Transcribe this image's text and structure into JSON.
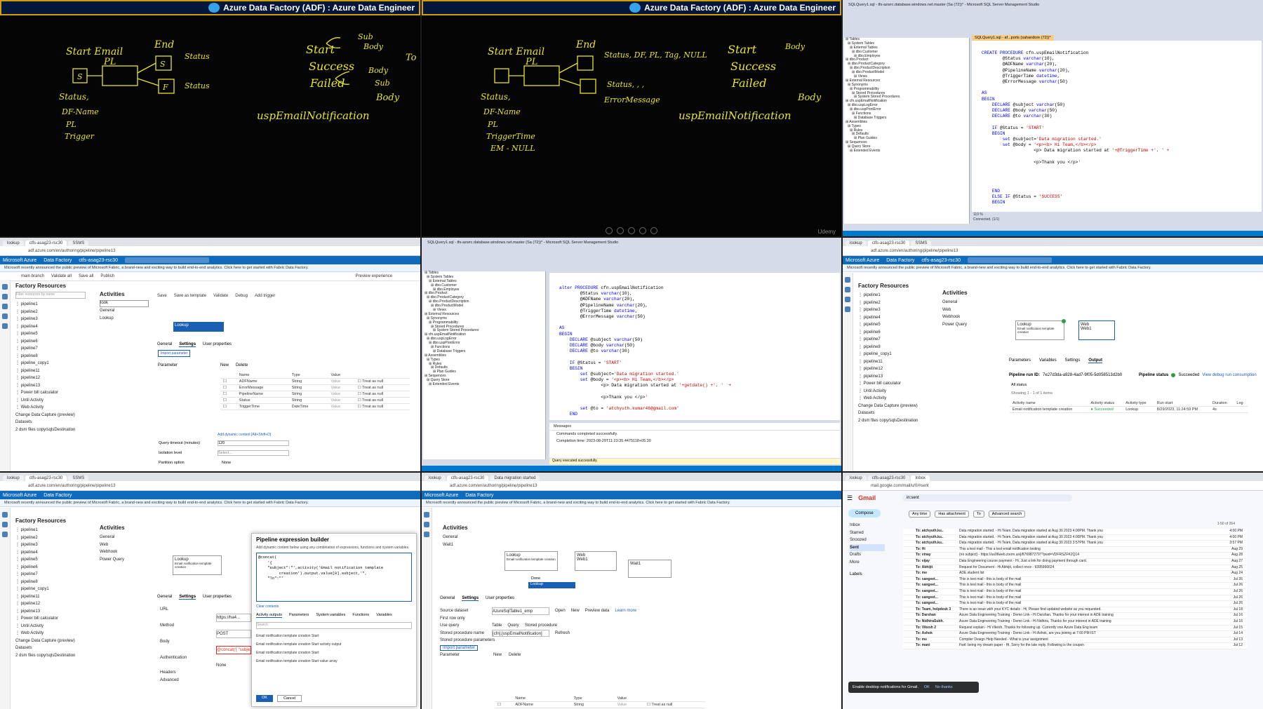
{
  "whiteboard": {
    "banner_title": "Azure Data Factory (ADF) : Azure Data Engineer",
    "watermark": "Udemy",
    "left_sketch": {
      "start_email": "Start Email",
      "pl": "PL",
      "end": "End",
      "s": "S",
      "f": "F",
      "status": "Status",
      "status_label": "Status,",
      "df_name": "DF-Name",
      "pl2": "PL",
      "trigger": "Trigger",
      "start": "Start",
      "success": "Success",
      "failed": "Failed",
      "sub": "Sub",
      "body": "Body",
      "to": "To",
      "sp": "uspEmailNotification"
    },
    "right_sketch": {
      "status_line": "Status, DF, PL, Tag, NULL",
      "error_line": "Status, , ,",
      "error_message": "ErrorMessage",
      "triggertime": "TriggerTime",
      "em_null": "EM - NULL"
    }
  },
  "ssms_top": {
    "title": "SQLQuery1.sql - tfs-azwrc.database.windows.net.master (Sa (72))* - Microsoft SQL Server Management Studio",
    "tab": "SQLQuery1.sql - af...ports (sahandore (72))*",
    "zoom": "110 %",
    "status": "Connected. (1/1)",
    "code": [
      "CREATE PROCEDURE cfn.uspEmailNotification",
      "        @Status varchar(10),",
      "        @ADFName varchar(20),",
      "        @PipelineName varchar(20),",
      "        @TriggerTime datetime,",
      "        @ErrorMessage varchar(50)",
      "",
      "AS",
      "BEGIN",
      "    DECLARE @subject varchar(50)",
      "    DECLARE @body varchar(50)",
      "    DECLARE @to varchar(30)",
      "",
      "    IF @Status = 'START'",
      "    BEGIN",
      "        set @subject='Data migration started.'",
      "        set @body = '<p><b> Hi Team,</b></p>",
      "                    <p> Data migration started at '+@TriggerTime +'. ' +",
      "",
      "                    <p>Thank you </p>'",
      "",
      "",
      "",
      "",
      "    END",
      "    ELSE IF @Status = 'SUCCESS'",
      "    BEGIN"
    ]
  },
  "ssms_mid": {
    "title": "SQLQuery1.sql - tfs-azwrc.database.windows.net.master (Sa (72))* - Microsoft SQL Server Management Studio",
    "messages_tab": "Messages",
    "message": "Commands completed successfully.",
    "completion": "Completion time: 2023-08-29T11:23:35.4475118+05:30",
    "query_status": "Query executed successfully.",
    "code": [
      "alter PROCEDURE cfn.uspEmailNotification",
      "        @Status varchar(10),",
      "        @ADFName varchar(20),",
      "        @PipelineName varchar(20),",
      "        @TriggerTime datetime,",
      "        @ErrorMessage varchar(50)",
      "",
      "AS",
      "BEGIN",
      "    DECLARE @subject varchar(50)",
      "    DECLARE @body varchar(50)",
      "    DECLARE @to varchar(30)",
      "",
      "    IF @Status = 'START'",
      "    BEGIN",
      "        set @subject='Data migration started.'",
      "        set @body = '<p><b> Hi Team,</b></p>",
      "                <p> Data migration started at '+getdate() +'. '  +",
      "",
      "                <p>Thank you </p>'",
      "",
      "        set @to = 'atchyuth.kumar46@gmail.com'",
      "    END"
    ]
  },
  "object_explorer_items": [
    "Tables",
    "System Tables",
    "External Tables",
    "dbo.Customer",
    "dbo.Employee",
    "dbo.Product",
    "dbo.ProductCategory",
    "dbo.ProductDescription",
    "dbo.ProductModel",
    "Views",
    "External Resources",
    "Synonyms",
    "Programmability",
    "Stored Procedures",
    "System Stored Procedures",
    "cfn.uspEmailNotification",
    "dbo.uspLogError",
    "dbo.uspPrintError",
    "Functions",
    "Database Triggers",
    "Assemblies",
    "Types",
    "Rules",
    "Defaults",
    "Plan Guides",
    "Sequences",
    "Query Store",
    "Extended Events"
  ],
  "azure": {
    "brand": "Microsoft Azure",
    "factory": "Data Factory",
    "factory_name": "ctfs-asag23-rsc30",
    "search_placeholder": "Search factory and documentation",
    "notice": "Microsoft recently announced the public preview of Microsoft Fabric, a brand-new and exciting way to build end-to-end analytics. Click here to get started with Fabric Data Factory.",
    "branch": "main branch",
    "validate_all": "Validate all",
    "save_all": "Save all",
    "publish": "Publish",
    "preview": "Preview experience",
    "off": "Off",
    "factory_resources": "Factory Resources",
    "filter_placeholder": "Filter resources by name",
    "pipelines": [
      "pipeline1",
      "pipeline2",
      "pipeline3",
      "pipeline4",
      "pipeline5",
      "pipeline6",
      "pipeline7",
      "pipeline8",
      "pipeline_copy1",
      "pipeline11",
      "pipeline12",
      "pipeline13"
    ],
    "extras": [
      "Power bill calculator",
      "Until Activity",
      "Web Activity"
    ],
    "cdc": "Change Data Capture (preview)",
    "datasets": "Datasets",
    "dataset_item": "2 dsm files copy/sqlsDestination",
    "activities": "Activities",
    "activity_search": "look",
    "general": "General",
    "lookup": "Lookup",
    "web": "Web",
    "webhook": "Webhook",
    "power_query": "Power Query",
    "toolbar": [
      "Save",
      "Save as template",
      "Validate",
      "Debug",
      "Add trigger"
    ],
    "tabs": [
      "General",
      "Settings",
      "User properties"
    ],
    "import_parameter": "Import parameter",
    "parameter_heading": "Parameter",
    "new": "New",
    "delete": "Delete",
    "param_columns": [
      "Name",
      "Type",
      "Value"
    ],
    "params": [
      {
        "name": "ADFName",
        "type": "String",
        "value": "Value"
      },
      {
        "name": "ErrorMessage",
        "type": "String",
        "value": "Value"
      },
      {
        "name": "PipelineName",
        "type": "String",
        "value": "Value"
      },
      {
        "name": "Status",
        "type": "String",
        "value": "Value"
      },
      {
        "name": "TriggerTime",
        "type": "DateTime",
        "value": "Value"
      }
    ],
    "treat_as_null": "Treat as null",
    "dynamic_content": "Add dynamic content [Alt+Shift+D]",
    "query_timeout": "Query timeout (minutes)",
    "query_timeout_value": "120",
    "isolation_level": "Isolation level",
    "isolation_value": "Select...",
    "partition_option": "Partition option",
    "partition_value": "None",
    "lookup_node": "Lookup",
    "lookup_sub": "Email notification template creation",
    "web_node": "Web1",
    "wait_node": "Wait1",
    "done": "Done"
  },
  "run": {
    "output_tabs": [
      "Parameters",
      "Variables",
      "Settings",
      "Output"
    ],
    "run_id_label": "Pipeline run ID:",
    "run_id": "7e27d3da-a928-4ad7-9f05-5d058513d2b0",
    "status_label": "Pipeline status",
    "status": "Succeeded",
    "debug_link": "View debug run consumption",
    "all_status": "All status",
    "showing": "Showing 1 - 1 of 1 items",
    "columns": [
      "Activity name",
      "Activity status",
      "Activity type",
      "Run start",
      "Duration",
      "Log"
    ],
    "row": {
      "name": "Email notification template creation",
      "status": "Succeeded",
      "type": "Lookup",
      "start": "8/29/2023, 11:24:59 PM",
      "duration": "4s",
      "log": ""
    }
  },
  "builder": {
    "title": "Pipeline expression builder",
    "hint": "Add dynamic content below using any combination of expressions, functions and system variables.",
    "expression": [
      "@concat(",
      "    '{",
      "    \"subject\":\"',activity('Email notification template",
      "         creation').output.value[0].subject,'\",",
      "    \"To\":\"'"
    ],
    "clear": "Clear contents",
    "tabs": [
      "Activity outputs",
      "Parameters",
      "System variables",
      "Functions",
      "Variables"
    ],
    "search": "Search",
    "items": [
      "Email notification template creation Start",
      "Email notification template creation Start activity output",
      "Email notification template creation Start",
      "Email notification template creation Start value array"
    ],
    "ok": "OK",
    "cancel": "Cancel"
  },
  "web_settings": {
    "url_label": "URL",
    "url_value": "https://ha4...",
    "method_label": "Method",
    "method_value": "POST",
    "body_label": "Body",
    "body_value": "@concat('{ \"subje...",
    "auth_label": "Authentication",
    "auth_value": "None",
    "headers": "Headers",
    "advanced": "Advanced"
  },
  "lookup_settings": {
    "source_dataset": "Source dataset",
    "source_value": "AzureSqlTable1_emp",
    "open": "Open",
    "preview_data": "Preview data",
    "learn_more": "Learn more",
    "first_row": "First row only",
    "use_query": "Use query",
    "table": "Table",
    "query": "Query",
    "stored_procedure": "Stored procedure",
    "sp_name": "Stored procedure name",
    "sp_value": "[cfn].[uspEmailNotification]",
    "refresh": "Refresh",
    "sp_params": "Stored procedure parameters",
    "import_parameter": "Import parameter"
  },
  "gmail": {
    "brand": "Gmail",
    "search": "in:sent",
    "compose": "Compose",
    "nav": [
      "Inbox",
      "Starred",
      "Snoozed",
      "Sent",
      "Drafts",
      "More"
    ],
    "labels": "Labels",
    "filters": [
      "Any time",
      "Has attachment",
      "To",
      "Advanced search"
    ],
    "count": "1-50 of 264",
    "rows": [
      {
        "s": "To: atchyuth.ku..",
        "b": "Data migration started. - Hi Team, Data migration started at Aug 30 2023 4:00PM. Thank you",
        "d": "4:00 PM"
      },
      {
        "s": "To: atchyuth.ku..",
        "b": "Data migration started. - Hi Team, Data migration started at Aug 30 2023 4:00PM. Thank you",
        "d": "4:00 PM"
      },
      {
        "s": "To: atchyuth.ku..",
        "b": "Data migration started. - Hi Team, Data migration started at Aug 30 2023 3:57PM. Thank you",
        "d": "3:57 PM"
      },
      {
        "s": "To: Hi",
        "b": "This a test mail - This a test email notification testing",
        "d": "Aug 29"
      },
      {
        "s": "To: vinay",
        "b": "{no subject} - https://us06web.zoom.us/j/8769872797?pwd=VDFRSZFK2Q14",
        "d": "Aug 28"
      },
      {
        "s": "To: vijay",
        "b": "Data Engineering course payment - Hi, Just a link for doing payment through card.",
        "d": "Aug 27"
      },
      {
        "s": "To: Abhijit",
        "b": "Request for Document - Hi Abhijit, collect once - 9395966624",
        "d": "Aug 25"
      },
      {
        "s": "To: me",
        "b": "ADE student list",
        "d": "Aug 24"
      },
      {
        "s": "To: sangeet...",
        "b": "This is test mail - this is body of the mail",
        "d": "Jul 26"
      },
      {
        "s": "To: sangeet...",
        "b": "This is test mail - this is body of the mail",
        "d": "Jul 26"
      },
      {
        "s": "To: sangeet...",
        "b": "This is test mail - this is body of the mail",
        "d": "Jul 26"
      },
      {
        "s": "To: sangeet...",
        "b": "This is test mail - this is body of the mail",
        "d": "Jul 26"
      },
      {
        "s": "To: sangeet...",
        "b": "This is test mail - this is body of the mail",
        "d": "Jul 26"
      },
      {
        "s": "To: Team, helpdesk 3",
        "b": "There is an issue with your KYC details - Hi, Please find updated website as you requested.",
        "d": "Jul 18"
      },
      {
        "s": "To: Darshan",
        "b": "Azure Data Engineering Training - Demo Link - Hi Darshan, Thanks for your interest in ADE training",
        "d": "Jul 16"
      },
      {
        "s": "To: NidhiraSubh.",
        "b": "Azure Data Engineering Training - Demo Link - Hi Nidhira, Thanks for your interest in ADE training",
        "d": "Jul 16"
      },
      {
        "s": "To: Vikesh 2",
        "b": "Request explain - Hi Vikesh, Thanks for following up. Currently one Azure Data Eng team",
        "d": "Jul 15"
      },
      {
        "s": "To: Ashok",
        "b": "Azure Data Engineering Training - Demo Link - Hi Ashok, are you joining at 7:00 PM IST",
        "d": "Jul 14"
      },
      {
        "s": "To: me",
        "b": "Compiler Design Help Needed - What is your assignment",
        "d": "Jul 13"
      },
      {
        "s": "To: mani",
        "b": "Fwd: being my dream paper - Hi, Sorry for the late reply. Following is the coupon",
        "d": "Jul 12"
      }
    ],
    "snackbar": "Enable desktop notifications for Gmail.",
    "snack_ok": "OK",
    "snack_no": "No thanks"
  },
  "colors": {
    "azure_blue": "#0f6cbd",
    "handwriting": "#e7e42a",
    "banner_border": "#d1a000",
    "ssms_status": "#007acc",
    "success": "#2e9e44",
    "gmail_red": "#d93025"
  }
}
